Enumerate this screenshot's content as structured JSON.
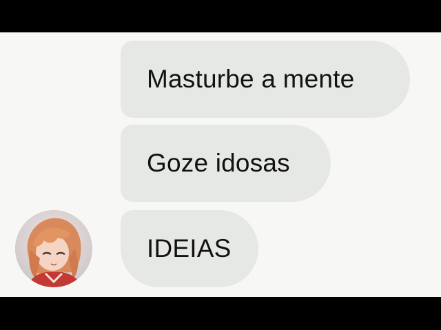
{
  "messages": [
    {
      "text": "Masturbe a mente"
    },
    {
      "text": "Goze idosas"
    },
    {
      "text": "IDEIAS"
    }
  ],
  "avatar": {
    "icon": "anime-character-avatar"
  },
  "colors": {
    "background": "#f7f8f6",
    "bubble": "#e6e8e5",
    "text": "#121212",
    "letterbox": "#000000"
  }
}
